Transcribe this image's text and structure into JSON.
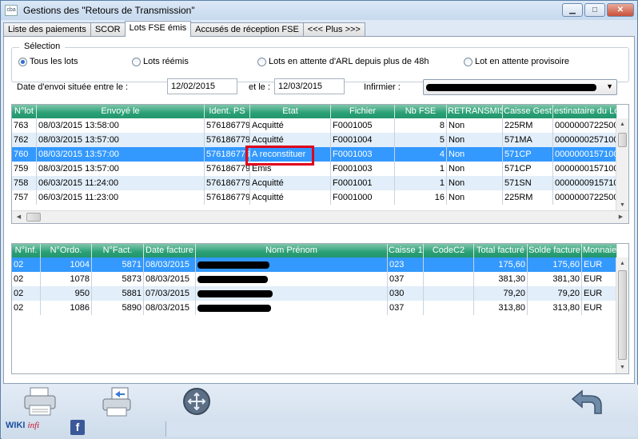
{
  "window": {
    "title": "Gestions des \"Retours de Transmission\"",
    "app_icon": "cba",
    "minimize": "▁",
    "maximize": "□",
    "close": "✕"
  },
  "tabs": [
    {
      "label": "Liste des paiements"
    },
    {
      "label": "SCOR"
    },
    {
      "label": "Lots FSE émis"
    },
    {
      "label": "Accusés de réception FSE"
    },
    {
      "label": "<<< Plus >>>"
    }
  ],
  "selection": {
    "label": "Sélection",
    "options": [
      {
        "label": "Tous les lots",
        "checked": true
      },
      {
        "label": "Lots réémis",
        "checked": false
      },
      {
        "label": "Lots en attente d'ARL depuis plus de 48h",
        "checked": false
      },
      {
        "label": "Lot en attente provisoire",
        "checked": false
      }
    ]
  },
  "filters": {
    "date_label": "Date d'envoi située entre le :",
    "date_from": "12/02/2015",
    "and_label": "et le :",
    "date_to": "12/03/2015",
    "nurse_label": "Infirmier :"
  },
  "lots_table": {
    "headers": [
      "N°lot",
      "Envoyé le",
      "Ident. PS",
      "Etat",
      "Fichier",
      "Nb FSE",
      "RETRANSMIS",
      "Caisse Gest.",
      "estinataire du Lo"
    ],
    "rows": [
      [
        "763",
        "08/03/2015 13:58:00",
        "576186779",
        "Acquitté",
        "F0001005",
        "8",
        "Non",
        "225RM",
        "0000000722500"
      ],
      [
        "762",
        "08/03/2015 13:57:00",
        "576186779",
        "Acquitté",
        "F0001004",
        "5",
        "Non",
        "571MA",
        "0000000257100"
      ],
      [
        "760",
        "08/03/2015 13:57:00",
        "576186779",
        "A reconstituer",
        "F0001003",
        "4",
        "Non",
        "571CP",
        "0000000157100"
      ],
      [
        "759",
        "08/03/2015 13:57:00",
        "576186779",
        "Emis",
        "F0001003",
        "1",
        "Non",
        "571CP",
        "0000000157100"
      ],
      [
        "758",
        "06/03/2015 11:24:00",
        "576186779",
        "Acquitté",
        "F0001001",
        "1",
        "Non",
        "571SN",
        "0000000915710"
      ],
      [
        "757",
        "06/03/2015 11:23:00",
        "576186779",
        "Acquitté",
        "F0001000",
        "16",
        "Non",
        "225RM",
        "0000000722500"
      ]
    ],
    "selected_index": 2
  },
  "invoices_table": {
    "headers": [
      "N°Inf.",
      "N°Ordo.",
      "N°Fact.",
      "Date facture",
      "Nom Prénom",
      "Caisse 1",
      "CodeC2",
      "Total facturé",
      "Solde facture",
      "Monnaie"
    ],
    "rows": [
      [
        "02",
        "1004",
        "5871",
        "08/03/2015",
        "",
        "023",
        "",
        "175,60",
        "175,60",
        "EUR"
      ],
      [
        "02",
        "1078",
        "5873",
        "08/03/2015",
        "",
        "037",
        "",
        "381,30",
        "381,30",
        "EUR"
      ],
      [
        "02",
        "950",
        "5881",
        "07/03/2015",
        "",
        "030",
        "",
        "79,20",
        "79,20",
        "EUR"
      ],
      [
        "02",
        "1086",
        "5890",
        "08/03/2015",
        "",
        "037",
        "",
        "313,80",
        "313,80",
        "EUR"
      ]
    ],
    "selected_index": 0
  },
  "bottom": {
    "wiki_prefix": "WIKI",
    "wiki_suffix": "infi",
    "facebook": "f",
    "icons": [
      "printer-icon",
      "print-export-icon",
      "sync-arrows-icon",
      "back-arrow-icon"
    ]
  },
  "colors": {
    "header_green": "#2aa077",
    "selection_blue": "#3399ff",
    "highlight_red": "#e0001b"
  }
}
